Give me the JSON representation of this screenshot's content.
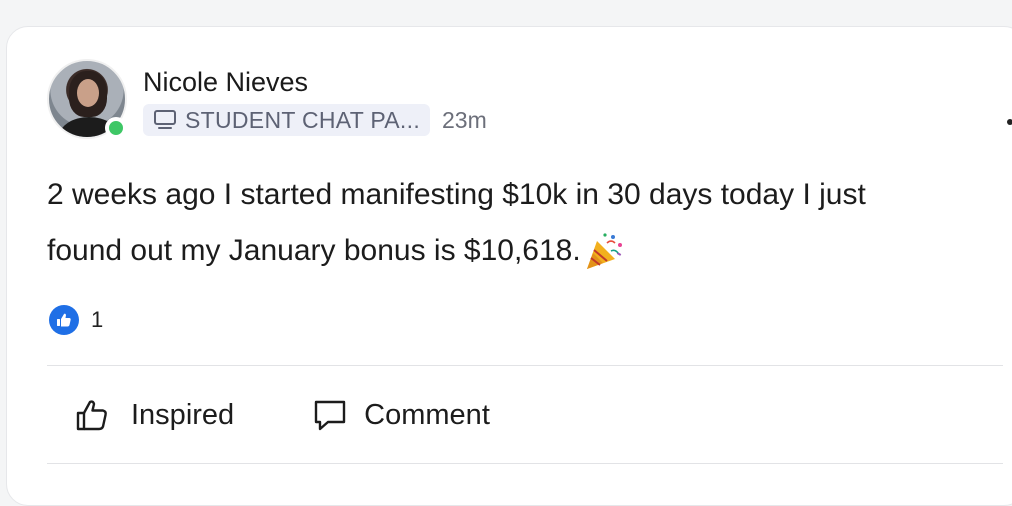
{
  "post": {
    "author": {
      "name": "Nicole Nieves",
      "online": true
    },
    "group": {
      "label": "STUDENT CHAT PA...",
      "icon": "monitor-icon"
    },
    "time": "23m",
    "text_line1": "2 weeks ago I started manifesting $10k in 30 days today I just",
    "text_line2": "found out my January bonus is $10,618.",
    "emoji": "party-popper-icon",
    "reactions": {
      "icon": "thumbs-up-icon",
      "count": "1"
    },
    "actions": {
      "inspired_label": "Inspired",
      "comment_label": "Comment"
    },
    "menu_icon": "more-horizontal-icon"
  },
  "colors": {
    "online": "#3ec766",
    "like": "#1f6fe6",
    "chip_bg": "#eef0f8"
  }
}
